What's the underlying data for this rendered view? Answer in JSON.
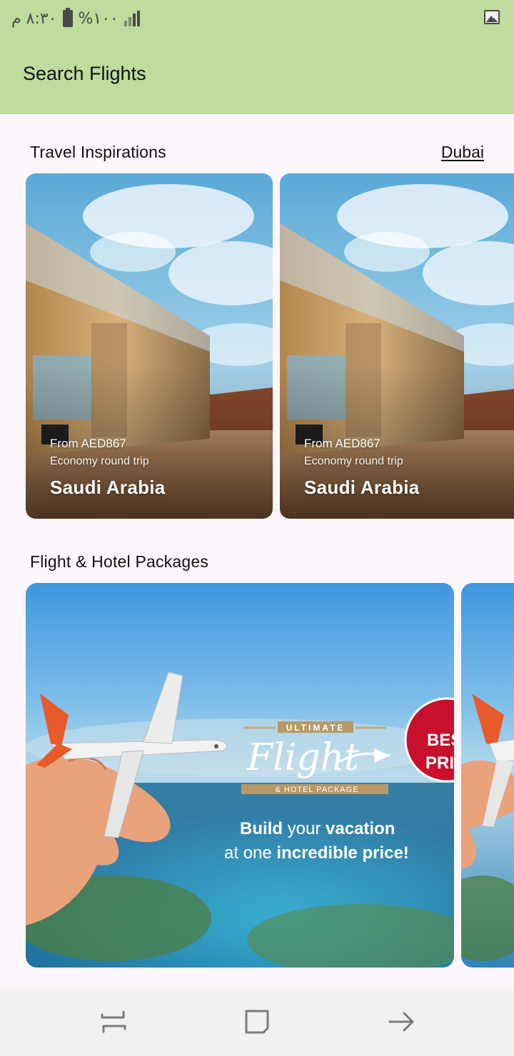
{
  "status_bar": {
    "time": "٨:٣٠ م",
    "battery": "%١٠٠",
    "icons": [
      "battery-icon",
      "signal-icon",
      "gallery-icon"
    ]
  },
  "app_bar": {
    "title": "Search Flights",
    "background": "#bfdb9d"
  },
  "inspirations": {
    "title": "Travel Inspirations",
    "city": "Dubai",
    "cards": [
      {
        "price": "From AED867",
        "trip": "Economy round trip",
        "destination": "Saudi Arabia"
      },
      {
        "price": "From AED867",
        "trip": "Economy round trip",
        "destination": "Saudi Arabia"
      }
    ]
  },
  "packages": {
    "title": "Flight & Hotel Packages",
    "banner": {
      "ribbon": "ULTIMATE",
      "script": "Flight",
      "subtitle": "& HOTEL PACKAGE",
      "line1_a": "Build",
      "line1_b": " your ",
      "line1_c": "vacation",
      "line2_a": "at one ",
      "line2_b": "incredible price!",
      "badge_1": "BES",
      "badge_2": "PRI"
    }
  },
  "nav_bar": {
    "buttons": [
      "recent-apps",
      "home",
      "back"
    ]
  },
  "colors": {
    "accent": "#bfdb9d",
    "page_bg": "#fdf6fd",
    "badge_red": "#c8102e"
  }
}
